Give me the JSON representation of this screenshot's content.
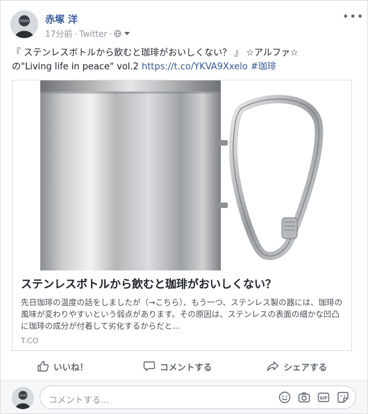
{
  "post": {
    "author": "赤塚 洋",
    "time": "17分前",
    "separator1": "·",
    "source": "Twitter",
    "separator2": "·",
    "text_line1": "『 ステンレスボトルから飲むと珈琲がおいしくない？ 』 ☆アルファ☆",
    "text_line2_prefix": "の\"Living life in peace\" vol.2 ",
    "text_link": "https://t.co/YKVA9Xxelo",
    "text_hashtag": "#珈琲",
    "menu_icon": "more-dots-icon"
  },
  "attachment": {
    "title": "ステンレスボトルから飲むと珈琲がおいしくない？",
    "description": "先日珈琲の温度の話をしましたが（→こちら）、もう一つ、ステンレス製の器には、珈琲の風味が変わりやすいという弱点があります。その原因は、ステンレスの表面の細かな凹凸に珈琲の成分が付着して劣化するからだと...",
    "domain": "T.CO"
  },
  "actions": {
    "like": "いいね！",
    "comment": "コメントする",
    "share": "シェアする"
  },
  "comment_box": {
    "placeholder": "コメントする..."
  },
  "colors": {
    "link": "#365899",
    "muted": "#90949c",
    "action": "#606770"
  }
}
